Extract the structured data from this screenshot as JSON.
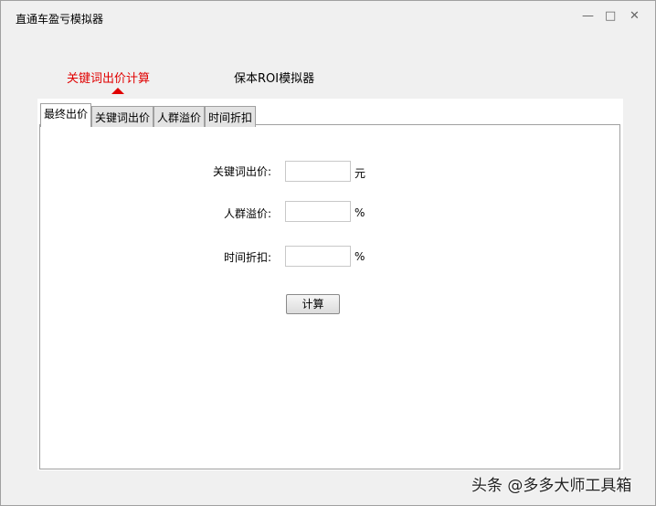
{
  "window": {
    "title": "直通车盈亏模拟器",
    "minimize": "—",
    "maximize": "□",
    "close": "✕"
  },
  "top_tabs": [
    {
      "label": "关键词出价计算",
      "active": true
    },
    {
      "label": "保本ROI模拟器",
      "active": false
    }
  ],
  "tabs": [
    "最终出价",
    "关键词出价",
    "人群溢价",
    "时间折扣"
  ],
  "form": {
    "fields": [
      {
        "label": "关键词出价:",
        "value": "",
        "unit": "元"
      },
      {
        "label": "人群溢价:",
        "value": "",
        "unit": "%"
      },
      {
        "label": "时间折扣:",
        "value": "",
        "unit": "%"
      }
    ],
    "calculate": "计算"
  },
  "watermark": "头条 @多多大师工具箱",
  "colors": {
    "accent": "#e00000"
  }
}
